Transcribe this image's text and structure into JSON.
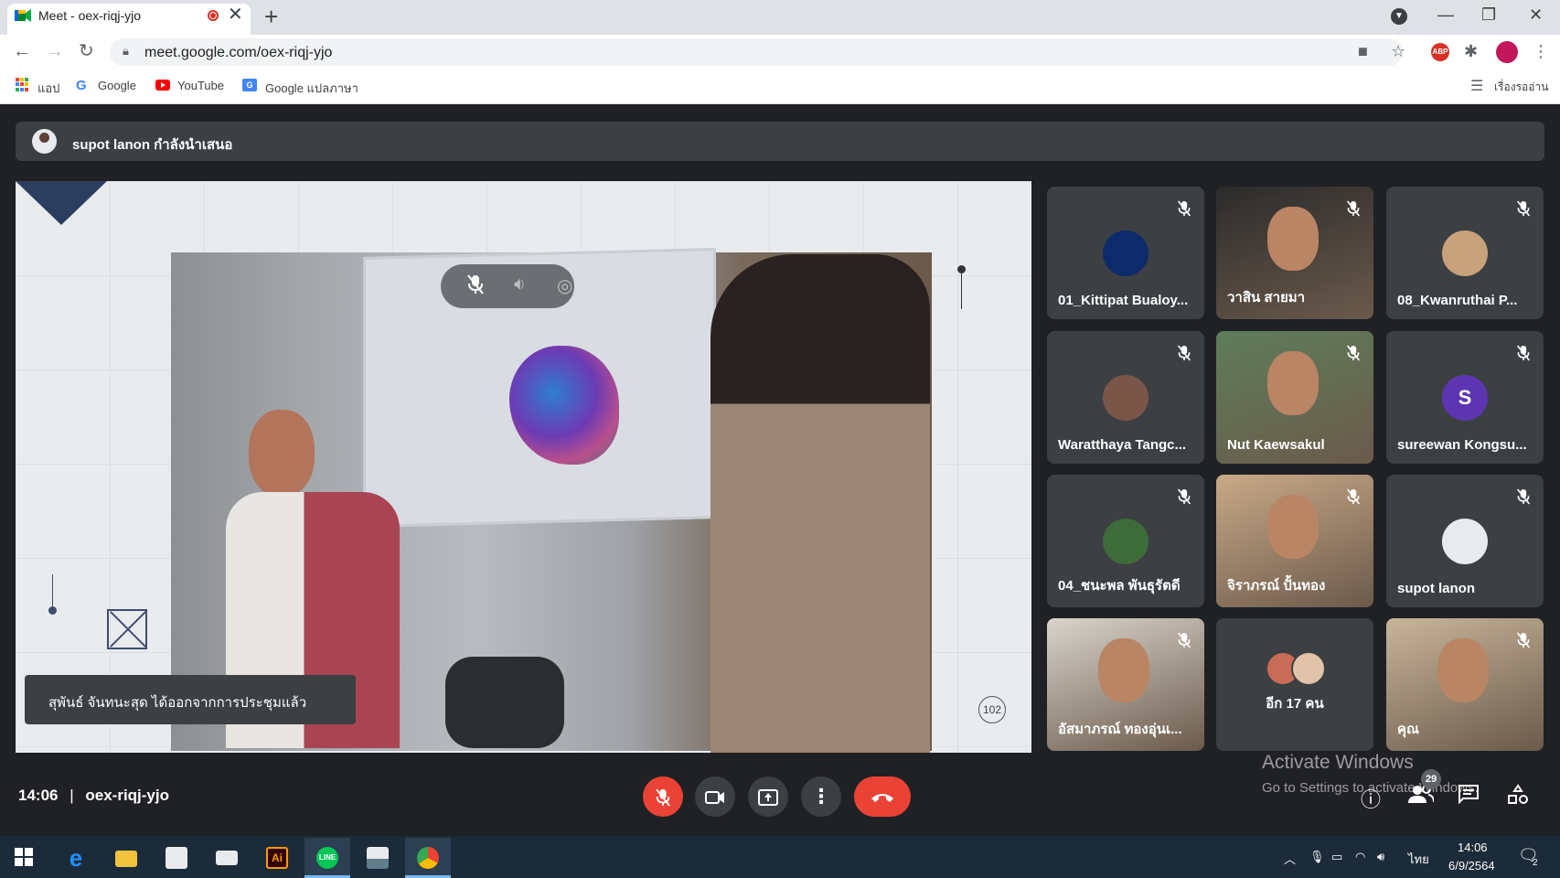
{
  "browser": {
    "tab_title": "Meet - oex-riqj-yjo",
    "tab_close": "✕",
    "new_tab": "+",
    "url": "meet.google.com/oex-riqj-yjo",
    "bookmarks": {
      "apps": "แอป",
      "google": "Google",
      "youtube": "YouTube",
      "translate": "Google แปลภาษา",
      "reading_list": "เรื่องรออ่าน"
    }
  },
  "meet": {
    "presenting_banner": "supot lanon กำลังนำเสนอ",
    "toast": "สุพันธ์ จันทนะสุด ได้ออกจากการประชุมแล้ว",
    "slide_number": "102",
    "time": "14:06",
    "separator": "|",
    "meeting_code": "oex-riqj-yjo",
    "participant_count": "29",
    "tiles": [
      {
        "name": "01_Kittipat Bualoy...",
        "kind": "avatar",
        "color": "#0d2a6b"
      },
      {
        "name": "วาสิน สายมา",
        "kind": "video",
        "color": "#2b2b2b"
      },
      {
        "name": "08_Kwanruthai P...",
        "kind": "avatar",
        "color": "#c8a27a"
      },
      {
        "name": "Waratthaya Tangc...",
        "kind": "avatar",
        "color": "#7a5648"
      },
      {
        "name": "Nut Kaewsakul",
        "kind": "video",
        "color": "#5e7d5a"
      },
      {
        "name": "sureewan Kongsu...",
        "kind": "letter",
        "letter": "S",
        "color": "#5e35b1"
      },
      {
        "name": "04_ชนะพล พันธุรัตดี",
        "kind": "avatar",
        "color": "#3e6b3a"
      },
      {
        "name": "จิราภรณ์ ปั้นทอง",
        "kind": "video",
        "color": "#c9a987"
      },
      {
        "name": "supot lanon",
        "kind": "avatar",
        "color": "#e8eaed"
      },
      {
        "name": "อัสมาภรณ์ ทองอุ่นเ...",
        "kind": "video",
        "color": "#d9d4cc"
      },
      {
        "name": "อีก 17 คน",
        "kind": "more",
        "color": "#3c4043"
      },
      {
        "name": "คุณ",
        "kind": "video",
        "color": "#c8b59a"
      }
    ]
  },
  "watermark": {
    "line1": "Activate Windows",
    "line2": "Go to Settings to activate Windows."
  },
  "taskbar": {
    "language": "ไทย",
    "clock_time": "14:06",
    "clock_date": "6/9/2564",
    "notification_count": "2"
  }
}
